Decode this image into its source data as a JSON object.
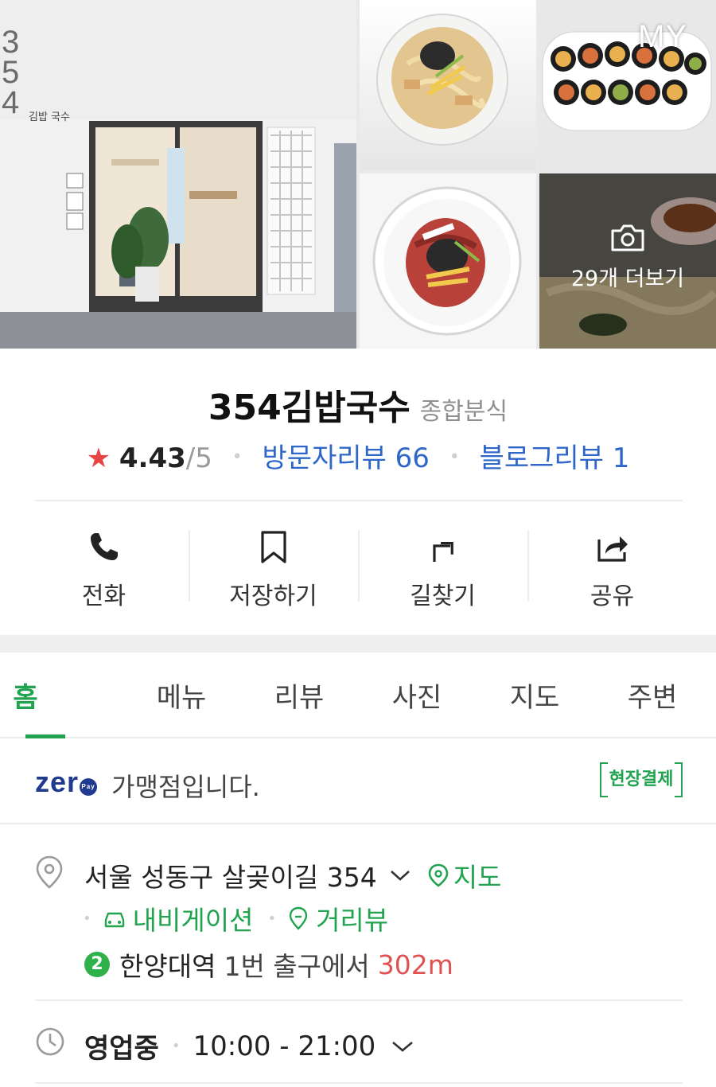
{
  "gallery": {
    "more_label": "29개 더보기",
    "my_label": "MY",
    "storefront_sign": "김밥 국수",
    "storefront_number": [
      "3",
      "5",
      "4"
    ]
  },
  "place": {
    "name": "354김밥국수",
    "category": "종합분식",
    "rating": "4.43",
    "rating_max": "/5",
    "visitor_reviews_label": "방문자리뷰 66",
    "blog_reviews_label": "블로그리뷰 1",
    "star_color": "#e64545"
  },
  "actions": [
    {
      "label": "전화",
      "icon": "phone-icon"
    },
    {
      "label": "저장하기",
      "icon": "bookmark-icon"
    },
    {
      "label": "길찾기",
      "icon": "directions-icon"
    },
    {
      "label": "공유",
      "icon": "share-icon"
    }
  ],
  "tabs": [
    {
      "label": "홈",
      "active": true
    },
    {
      "label": "메뉴",
      "active": false
    },
    {
      "label": "리뷰",
      "active": false
    },
    {
      "label": "사진",
      "active": false
    },
    {
      "label": "지도",
      "active": false
    },
    {
      "label": "주변",
      "active": false
    }
  ],
  "zeropay": {
    "logo_text": "zer",
    "logo_badge": "Pay",
    "text": "가맹점입니다.",
    "badge": "현장결제"
  },
  "address": {
    "text": "서울 성동구 살곶이길 354",
    "map_link": "지도",
    "navigation_link": "내비게이션",
    "street_view_link": "거리뷰",
    "subway_line": "2",
    "station": "한양대역",
    "exit": "1번 출구에서",
    "distance": "302m"
  },
  "hours": {
    "status": "영업중",
    "time": "10:00 - 21:00"
  },
  "colors": {
    "accent_green": "#21a350",
    "link_blue": "#2f67c9",
    "distance_red": "#e05252",
    "line2_green": "#2eb14b",
    "zeropay_navy": "#1f3a8f"
  }
}
